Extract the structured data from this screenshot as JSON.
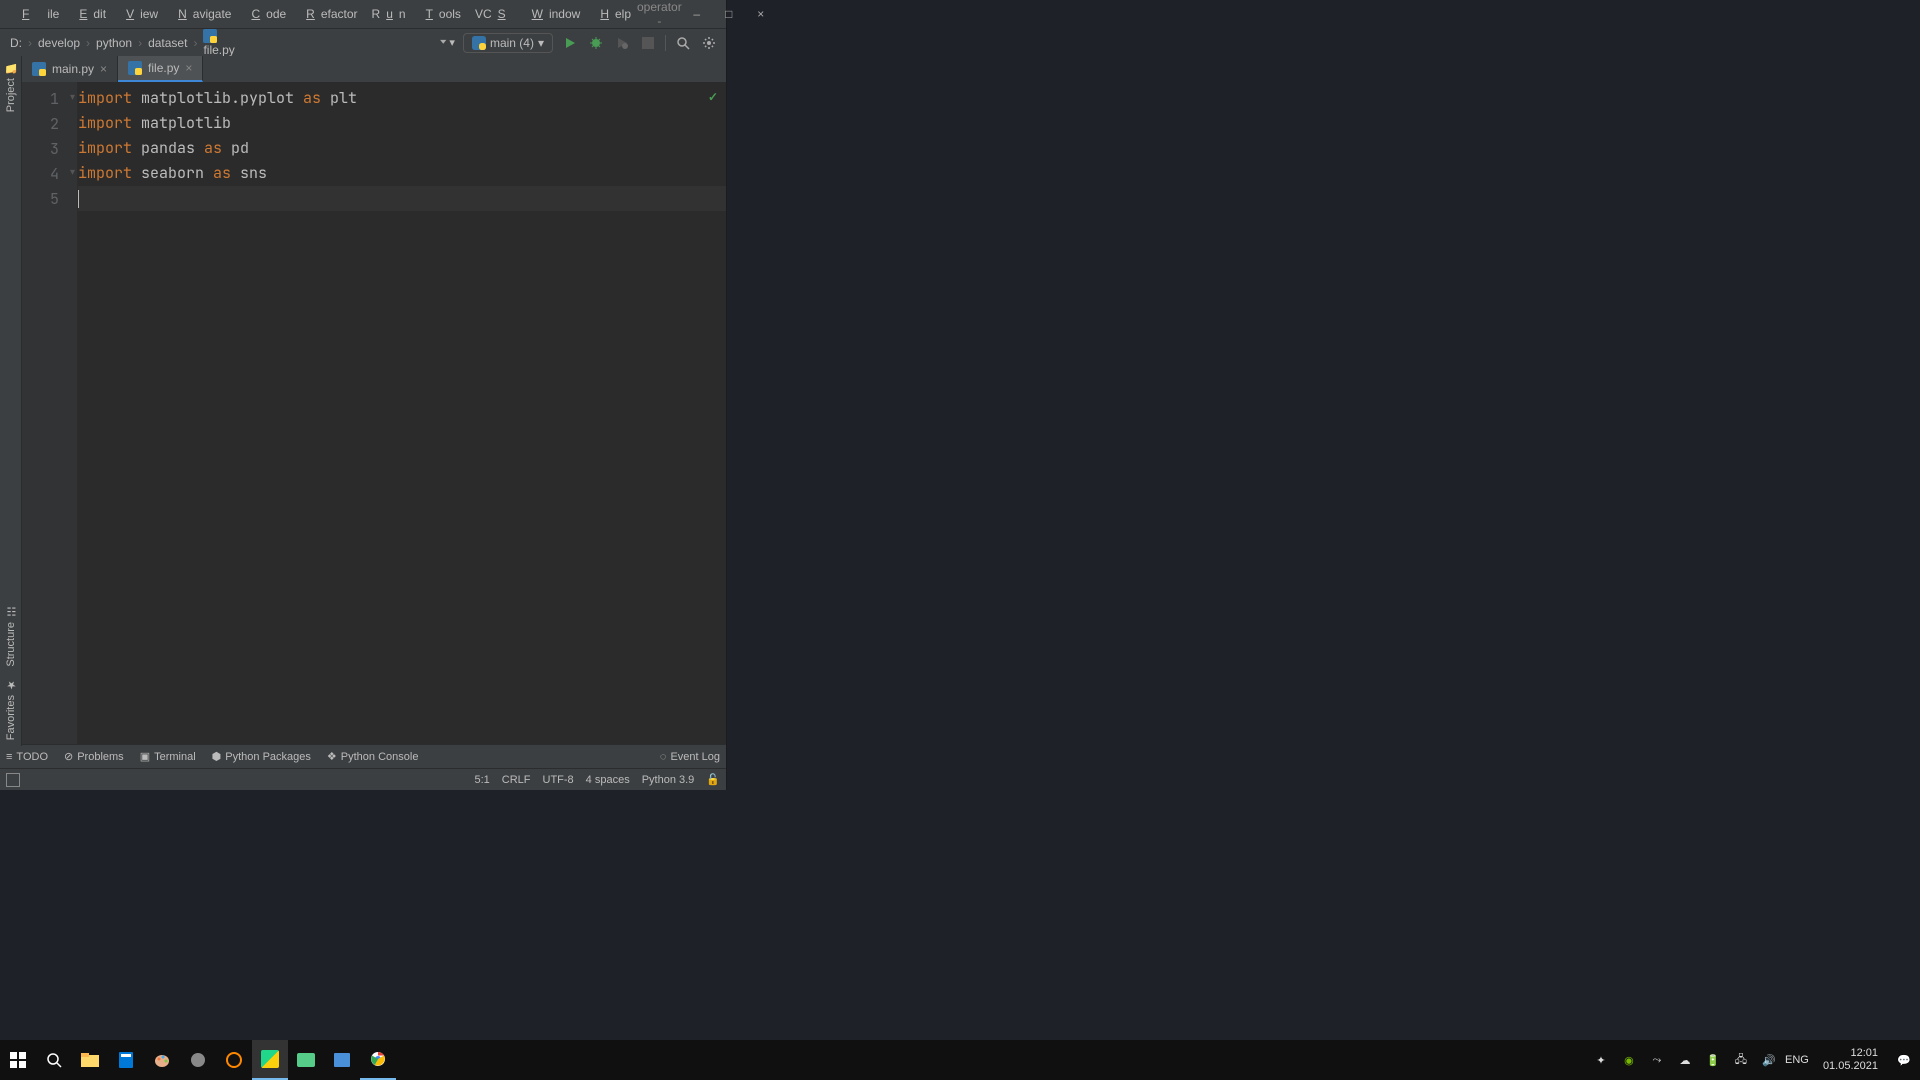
{
  "titlebar": {
    "menus": [
      "File",
      "Edit",
      "View",
      "Navigate",
      "Code",
      "Refactor",
      "Run",
      "Tools",
      "VCS",
      "Window",
      "Help"
    ],
    "title": "mobile operator - ...\\file.py",
    "minimize": "–",
    "maximize": "□",
    "close": "×"
  },
  "breadcrumbs": {
    "items": [
      "D:",
      "develop",
      "python",
      "dataset",
      "file.py"
    ]
  },
  "run_config": {
    "label": "main (4)"
  },
  "tabs": [
    {
      "label": "main.py",
      "active": false
    },
    {
      "label": "file.py",
      "active": true
    }
  ],
  "code": {
    "lines": [
      {
        "num": "1",
        "tokens": [
          {
            "t": "import",
            "k": true
          },
          {
            "t": " matplotlib.pyplot "
          },
          {
            "t": "as",
            "k": true
          },
          {
            "t": " plt"
          }
        ]
      },
      {
        "num": "2",
        "tokens": [
          {
            "t": "import",
            "k": true
          },
          {
            "t": " matplotlib"
          }
        ]
      },
      {
        "num": "3",
        "tokens": [
          {
            "t": "import",
            "k": true
          },
          {
            "t": " pandas "
          },
          {
            "t": "as",
            "k": true
          },
          {
            "t": " pd"
          }
        ]
      },
      {
        "num": "4",
        "tokens": [
          {
            "t": "import",
            "k": true
          },
          {
            "t": " seaborn "
          },
          {
            "t": "as",
            "k": true
          },
          {
            "t": " sns"
          }
        ]
      },
      {
        "num": "5",
        "tokens": [],
        "current": true
      }
    ]
  },
  "leftbar": {
    "project": "Project",
    "structure": "Structure",
    "favorites": "Favorites"
  },
  "bottombar": {
    "todo": "TODO",
    "problems": "Problems",
    "terminal": "Terminal",
    "packages": "Python Packages",
    "console": "Python Console",
    "eventlog": "Event Log"
  },
  "statusbar": {
    "pos": "5:1",
    "eol": "CRLF",
    "enc": "UTF-8",
    "indent": "4 spaces",
    "interpreter": "Python 3.9"
  },
  "tray": {
    "lang": "ENG",
    "time": "12:01",
    "date": "01.05.2021"
  }
}
